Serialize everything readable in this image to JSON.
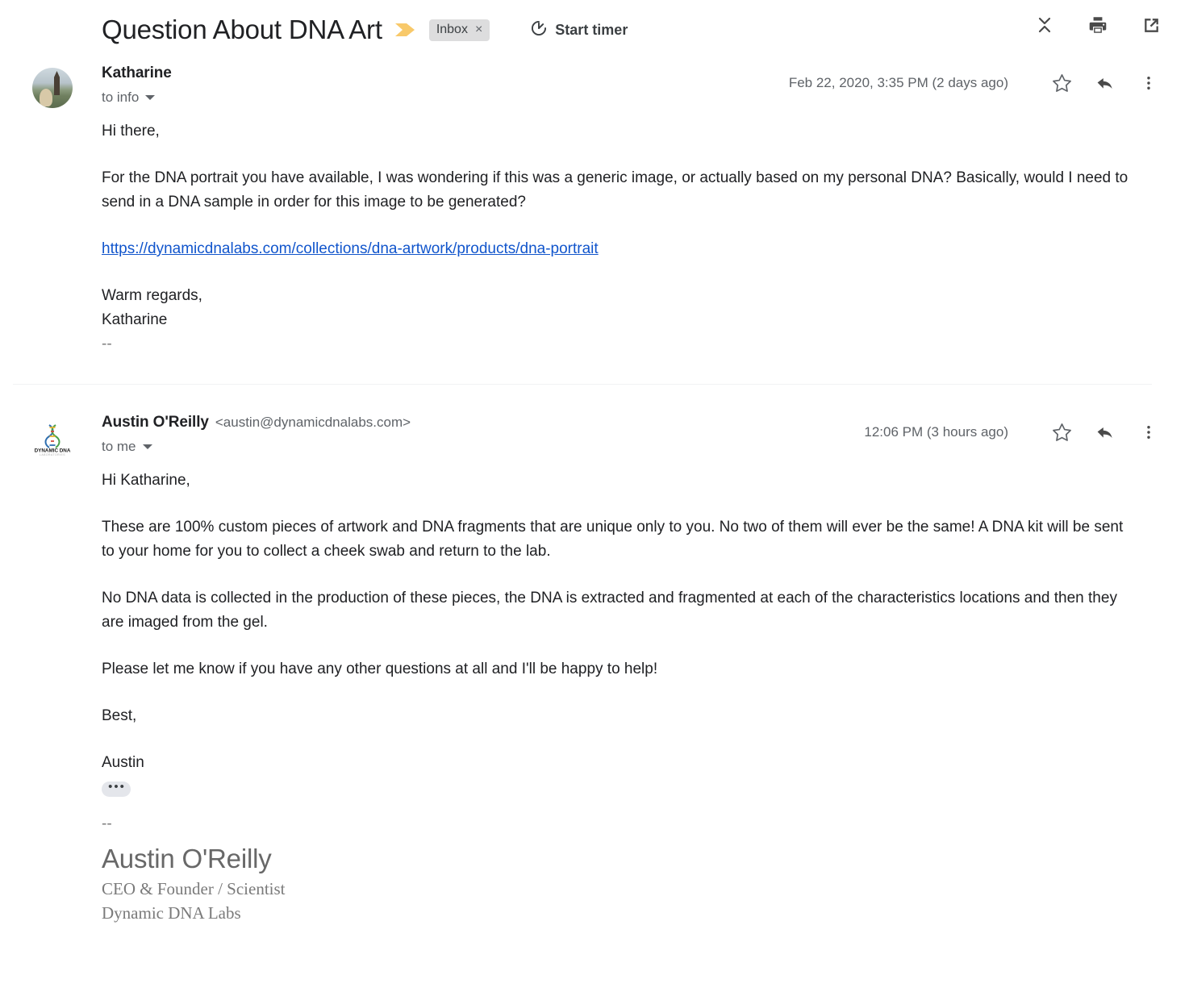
{
  "header": {
    "subject": "Question About DNA Art",
    "label_chip": "Inbox",
    "label_chip_remove": "×",
    "timer_label": "Start timer",
    "icons": {
      "collapse": "collapse-all-icon",
      "print": "print-icon",
      "popout": "open-in-new-window-icon"
    },
    "accent_chevron_color": "#f8c96a",
    "link_color": "#1155cc"
  },
  "messages": [
    {
      "avatar_type": "photo",
      "sender_name": "Katharine",
      "sender_email": "",
      "recipient": "to info",
      "date": "Feb 22, 2020, 3:35 PM (2 days ago)",
      "paragraphs": [
        "Hi there,",
        "For the DNA portrait you have available, I was wondering if this was a generic image, or actually based on my personal DNA? Basically, would I need to send in a DNA sample in order for this image to be generated?"
      ],
      "link_text": "https://dynamicdnalabs.com/collections/dna-artwork/products/dna-portrait",
      "closing_line1": "Warm regards,",
      "closing_line2": "Katharine",
      "signature_separator": "--"
    },
    {
      "avatar_type": "logo",
      "logo_line1": "DYNAMIC DNA",
      "logo_line2": "LABORATORIES",
      "sender_name": "Austin O'Reilly",
      "sender_email": "<austin@dynamicdnalabs.com>",
      "recipient": "to me",
      "date": "12:06 PM (3 hours ago)",
      "paragraphs": [
        "Hi Katharine,",
        "These are 100% custom pieces of artwork and DNA fragments that are unique only to you.  No two of them will ever be the same!  A DNA kit will be sent to your home for you to collect a cheek swab and return to the lab.",
        "No DNA data is collected in the production of these pieces, the DNA is extracted and fragmented at each of the characteristics locations and then they are imaged from the gel.",
        "Please let me know if you have any other questions at all and I'll be happy to help!",
        "Best,",
        "Austin"
      ],
      "trimmed_content_button": "•••",
      "signature_separator": "--",
      "signature_name": "Austin O'Reilly",
      "signature_role": "CEO & Founder / Scientist",
      "signature_company": "Dynamic DNA Labs"
    }
  ]
}
